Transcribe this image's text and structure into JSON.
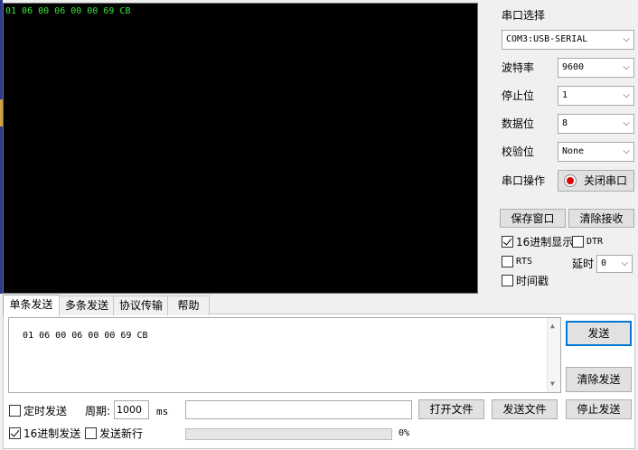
{
  "terminal": {
    "text": "01 06 00 06 00 00 69 CB"
  },
  "serial": {
    "port_label": "串口选择",
    "port_value": "COM3:USB-SERIAL",
    "baud_label": "波特率",
    "baud_value": "9600",
    "stop_label": "停止位",
    "stop_value": "1",
    "data_label": "数据位",
    "data_value": "8",
    "parity_label": "校验位",
    "parity_value": "None",
    "op_label": "串口操作",
    "toggle_button": "关闭串口",
    "indicator_color": "#e00000"
  },
  "controls": {
    "save_window": "保存窗口",
    "clear_receive": "清除接收",
    "hex_display": "16进制显示",
    "hex_display_checked": true,
    "dtr": "DTR",
    "rts": "RTS",
    "delay_label": "延时",
    "delay_value": "0",
    "timestamp": "时间戳"
  },
  "tabs": [
    {
      "label": "单条发送",
      "active": true
    },
    {
      "label": "多条发送",
      "active": false
    },
    {
      "label": "协议传输",
      "active": false
    },
    {
      "label": "帮助",
      "active": false
    }
  ],
  "send": {
    "text": "01 06 00 06 00 00 69 CB",
    "send_button": "发送",
    "clear_button": "清除发送",
    "timed_send": "定时发送",
    "period_label": "周期:",
    "period_value": "1000",
    "period_unit": "ms",
    "open_file": "打开文件",
    "send_file": "发送文件",
    "stop_send": "停止发送",
    "hex_send": "16进制发送",
    "hex_send_checked": true,
    "send_newline": "发送新行",
    "progress_percent": 0,
    "progress_text": "0%"
  }
}
